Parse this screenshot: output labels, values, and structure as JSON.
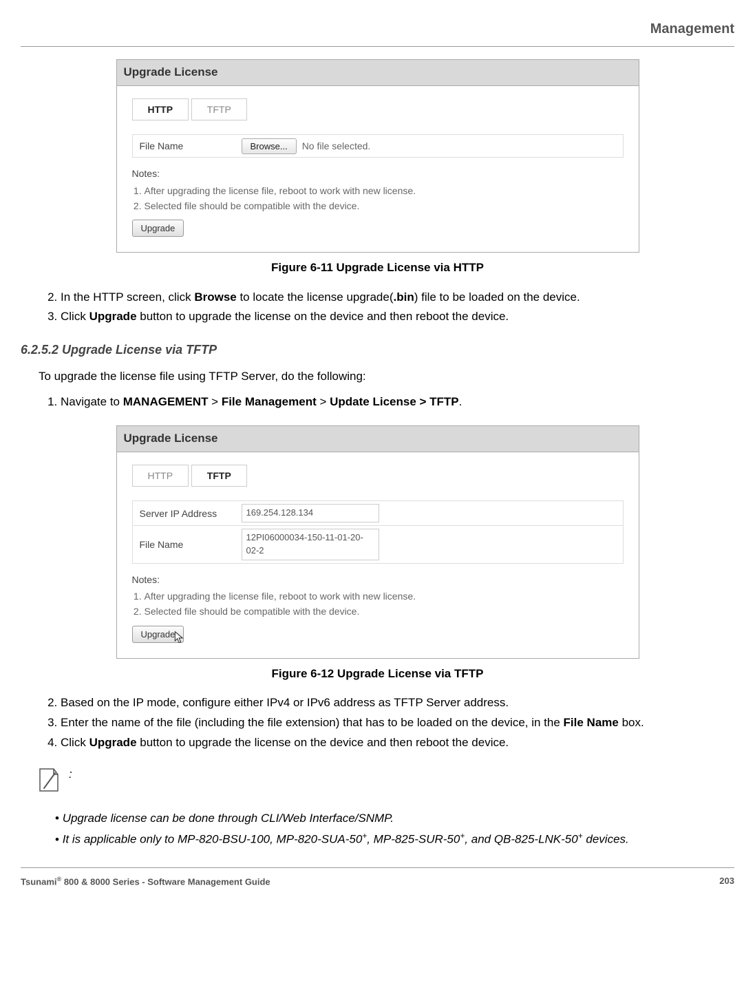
{
  "header": {
    "title": "Management"
  },
  "fig1": {
    "panel_title": "Upgrade License",
    "tab_http": "HTTP",
    "tab_tftp": "TFTP",
    "file_name_label": "File Name",
    "browse_label": "Browse...",
    "no_file_text": "No file selected.",
    "notes_label": "Notes:",
    "note1": "After upgrading the license file, reboot to work with new license.",
    "note2": "Selected file should be compatible with the device.",
    "upgrade_label": "Upgrade",
    "caption": "Figure 6-11 Upgrade License via HTTP"
  },
  "steps1": {
    "s2a": "In the HTTP screen, click ",
    "s2b": "Browse",
    "s2c": " to locate the license upgrade(",
    "s2d": ".bin",
    "s2e": ") file to be loaded on the device.",
    "s3a": "Click ",
    "s3b": "Upgrade",
    "s3c": " button to upgrade the license on the device and then reboot the device."
  },
  "section": {
    "heading": "6.2.5.2 Upgrade License via TFTP",
    "intro": "To upgrade the license file using TFTP Server, do the following:",
    "nav_a": "Navigate to ",
    "nav_b": "MANAGEMENT",
    "nav_c": " > ",
    "nav_d": "File Management",
    "nav_e": " > ",
    "nav_f": "Update License > TFTP",
    "nav_g": "."
  },
  "fig2": {
    "panel_title": "Upgrade License",
    "tab_http": "HTTP",
    "tab_tftp": "TFTP",
    "server_ip_label": "Server IP Address",
    "server_ip_value": "169.254.128.134",
    "file_name_label": "File Name",
    "file_name_value": "12PI06000034-150-11-01-20-02-2",
    "notes_label": "Notes:",
    "note1": "After upgrading the license file, reboot to work with new license.",
    "note2": "Selected file should be compatible with the device.",
    "upgrade_label": "Upgrade",
    "caption": "Figure 6-12 Upgrade License via TFTP"
  },
  "steps2": {
    "s2": "Based on the IP mode, configure either IPv4 or IPv6 address as TFTP Server address.",
    "s3a": "Enter the name of the file (including the file extension) that has to be loaded on the device, in the ",
    "s3b": "File Name",
    "s3c": " box.",
    "s4a": "Click ",
    "s4b": "Upgrade",
    "s4c": " button to upgrade the license on the device and then reboot the device."
  },
  "notes": {
    "colon": ":",
    "b1": "Upgrade license can be done through CLI/Web Interface/SNMP.",
    "b2a": "It is applicable only to MP-820-BSU-100, MP-820-SUA-50",
    "b2b": ", MP-825-SUR-50",
    "b2c": ", and QB-825-LNK-50",
    "b2d": " devices.",
    "plus": "+"
  },
  "footer": {
    "left_a": "Tsunami",
    "left_b": "®",
    "left_c": " 800 & 8000 Series - Software Management Guide",
    "right": "203"
  }
}
